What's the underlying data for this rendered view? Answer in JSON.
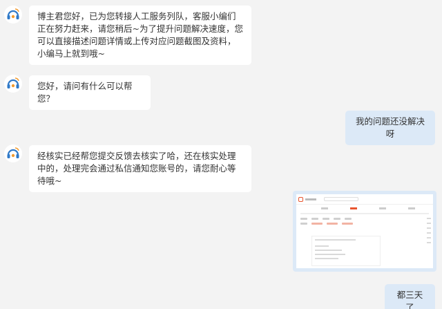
{
  "agent": {
    "avatar_icon": "headset-icon",
    "accent": "#2f79c8"
  },
  "messages": [
    {
      "from": "agent",
      "text": "博主君您好，已为您转接人工服务列队，客服小编们正在努力赶来，请您稍后~为了提升问题解决速度，您可以直接描述问题详情或上传对应问题截图及资料，小编马上就到哦~"
    },
    {
      "from": "agent",
      "text": "您好，请问有什么可以帮您？"
    },
    {
      "from": "user",
      "text": "我的问题还没解决呀"
    },
    {
      "from": "agent",
      "text": "经核实已经帮您提交反馈去核实了哈，还在核实处理中的，处理完会通过私信通知您账号的，请您耐心等待哦~"
    },
    {
      "from": "user",
      "type": "image"
    },
    {
      "from": "user",
      "text": "都三天了"
    }
  ]
}
